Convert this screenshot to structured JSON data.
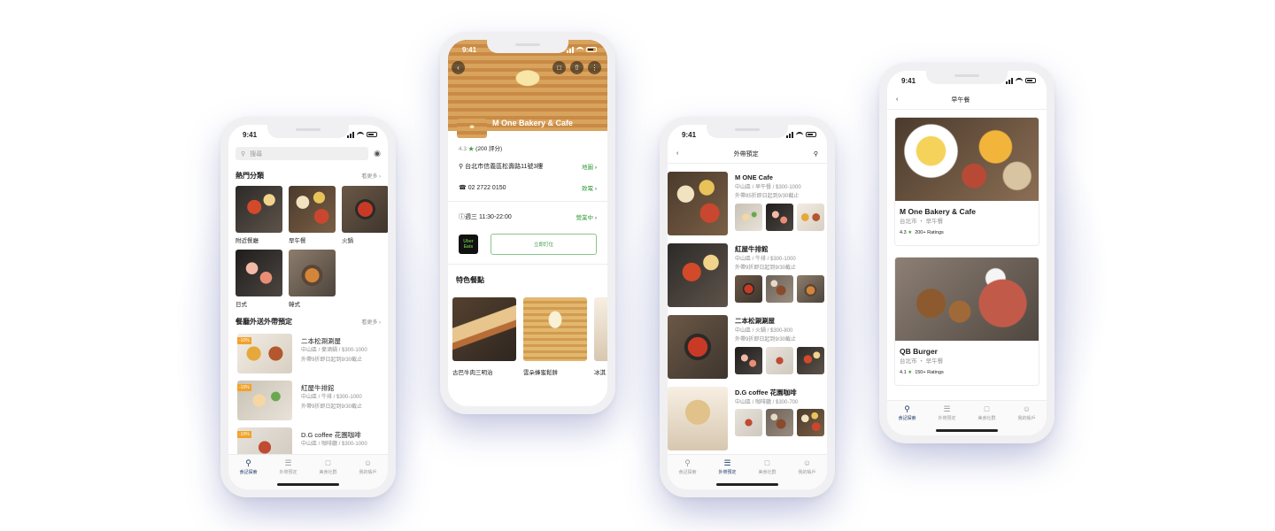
{
  "status_time": "9:41",
  "tabbar": [
    "食記探索",
    "外帶預定",
    "美食社群",
    "我的帳戶"
  ],
  "phone1": {
    "search_placeholder": "搜尋",
    "hot_title": "熱門分類",
    "more": "看更多",
    "categories": [
      "附近餐廳",
      "早午餐",
      "火鍋",
      "日式",
      "韓式"
    ],
    "delivery_title": "餐廳外送外帶預定",
    "discount": "-10%",
    "restaurants": [
      {
        "name": "二本松涮涮屋",
        "meta": "中山區 / 麥酒鍋 / $300-1000",
        "promo": "外帶9折即日起到9/30截止"
      },
      {
        "name": "紅屋牛排館",
        "meta": "中山區 / 牛排 / $300-1000",
        "promo": "外帶9折即日起到9/30截止"
      },
      {
        "name": "D.G coffee 花園咖啡",
        "meta": "中山區 / 咖啡廳 / $300-1000",
        "promo": ""
      }
    ]
  },
  "phone2": {
    "name": "M One Bakery & Cafe",
    "rating": "4.3",
    "reviews": "(200 評分)",
    "address": "台北市信義區松壽路11號3樓",
    "map": "地圖",
    "phone": "02 2722 0150",
    "call": "致電",
    "hours": "週三 11:30-22:00",
    "open": "營業中",
    "uber": "Uber Eats",
    "order": "立即訂位",
    "featured": "特色餐點",
    "dishes": [
      "古巴牛肉三明治",
      "雲朵蜂蜜鬆餅",
      "冰淇"
    ]
  },
  "phone3": {
    "title": "外帶預定",
    "restaurants": [
      {
        "name": "M ONE Cafe",
        "meta": "中山區 / 早午餐 / $300-1000",
        "promo": "外帶85折即日起到9/30截止"
      },
      {
        "name": "紅屋牛排館",
        "meta": "中山區 / 牛排 / $300-1000",
        "promo": "外帶9折即日起到9/30截止"
      },
      {
        "name": "二本松涮涮屋",
        "meta": "中山區 / 火鍋 / $300-800",
        "promo": "外帶9折即日起到9/30截止"
      },
      {
        "name": "D.G coffee 花園咖啡",
        "meta": "中山區 / 咖啡廳 / $300-700",
        "promo": ""
      }
    ]
  },
  "phone4": {
    "title": "早午餐",
    "cards": [
      {
        "name": "M One Bakery & Cafe",
        "meta": "台北市 ・ 早午餐",
        "rating": "4.3",
        "ratings": "200+ Ratings"
      },
      {
        "name": "QB Burger",
        "meta": "台北市 ・ 早午餐",
        "rating": "4.1",
        "ratings": "150+ Ratings"
      }
    ]
  },
  "colors": {
    "accent": "#3a9c3c",
    "nav_active": "#1f3b66",
    "discount": "#f2a22a"
  }
}
